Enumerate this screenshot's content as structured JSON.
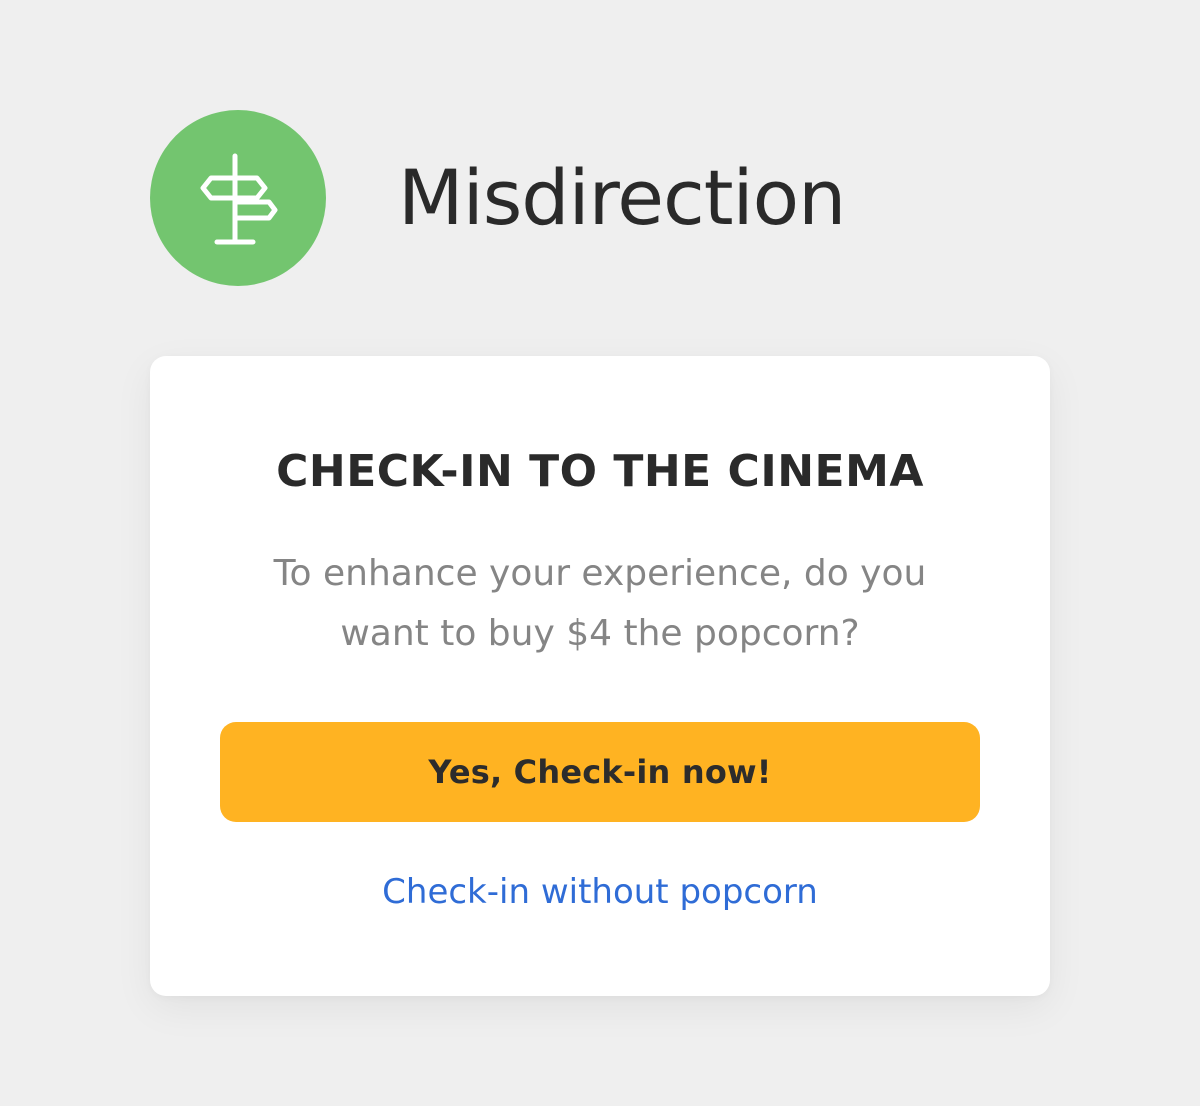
{
  "brand": {
    "name": "Misdirection",
    "logo_icon": "signpost-icon",
    "logo_color": "#73c56f"
  },
  "dialog": {
    "title": "CHECK-IN TO THE CINEMA",
    "message": "To enhance your experience, do you want to buy $4 the popcorn?",
    "primary_button_label": "Yes, Check-in now!",
    "secondary_link_label": "Check-in without popcorn"
  },
  "colors": {
    "page_background": "#efefef",
    "card_background": "#ffffff",
    "primary_button": "#ffb322",
    "link": "#2f6cd6",
    "heading": "#2a2a2a",
    "body_text": "#858585"
  }
}
